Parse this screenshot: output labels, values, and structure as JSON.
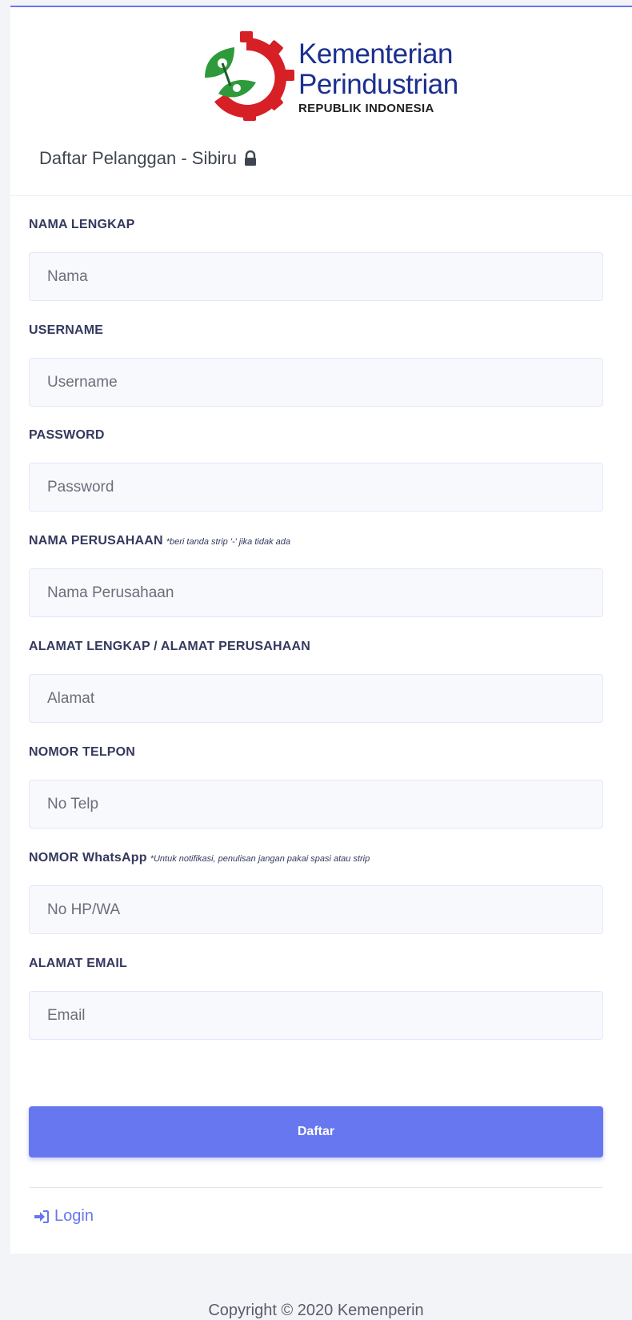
{
  "logo": {
    "line1": "Kementerian",
    "line2": "Perindustrian",
    "line3": "REPUBLIK INDONESIA"
  },
  "header": {
    "title": "Daftar Pelanggan - Sibiru"
  },
  "fields": [
    {
      "label": "NAMA LENGKAP",
      "hint": "",
      "placeholder": "Nama"
    },
    {
      "label": "USERNAME",
      "hint": "",
      "placeholder": "Username"
    },
    {
      "label": "PASSWORD",
      "hint": "",
      "placeholder": "Password"
    },
    {
      "label": "NAMA PERUSAHAAN",
      "hint": "*beri tanda strip '-' jika tidak ada",
      "placeholder": "Nama Perusahaan"
    },
    {
      "label": "ALAMAT LENGKAP / ALAMAT PERUSAHAAN",
      "hint": "",
      "placeholder": "Alamat"
    },
    {
      "label": "NOMOR TELPON",
      "hint": "",
      "placeholder": "No Telp"
    },
    {
      "label": "NOMOR WhatsApp",
      "hint": "*Untuk notifikasi, penulisan jangan pakai spasi atau strip",
      "placeholder": "No HP/WA"
    },
    {
      "label": "ALAMAT EMAIL",
      "hint": "",
      "placeholder": "Email"
    }
  ],
  "submit_label": "Daftar",
  "login_label": "Login",
  "footer_text": "Copyright © 2020 Kemenperin",
  "colors": {
    "primary": "#6777ef",
    "logo_red": "#d71f26",
    "logo_green": "#2e9a3c"
  }
}
